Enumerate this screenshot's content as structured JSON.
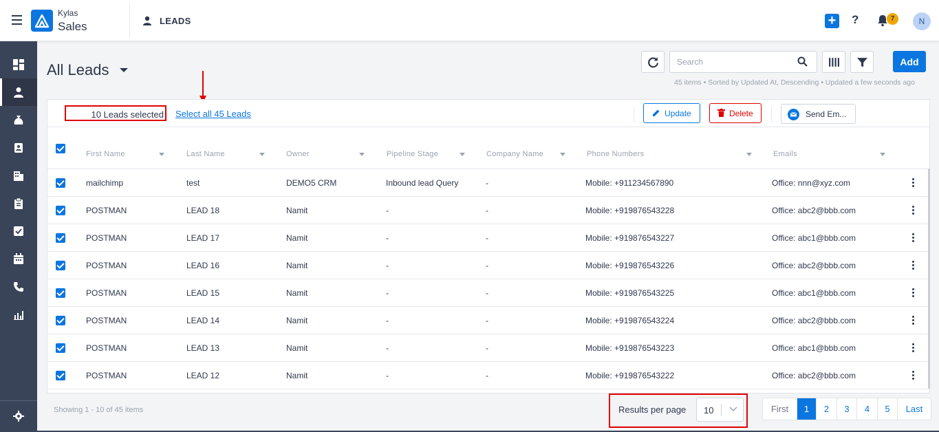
{
  "app": {
    "brand_top": "Kylas",
    "brand_sub": "Sales",
    "page_heading": "LEADS",
    "notifications_count": "7",
    "avatar_initial": "N"
  },
  "sidebar": {
    "items": [
      {
        "icon": "dashboard-icon"
      },
      {
        "icon": "leads-icon",
        "active": true
      },
      {
        "icon": "deals-icon"
      },
      {
        "icon": "contacts-icon"
      },
      {
        "icon": "companies-icon"
      },
      {
        "icon": "tasks-clipboard-icon"
      },
      {
        "icon": "checkbox-icon"
      },
      {
        "icon": "calendar-icon"
      },
      {
        "icon": "phone-icon"
      },
      {
        "icon": "reports-icon"
      }
    ],
    "settings_icon": "settings-icon"
  },
  "header": {
    "title": "All Leads",
    "search_placeholder": "Search",
    "add_label": "Add",
    "meta": "45 items • Sorted by Updated At, Descending • Updated a few seconds ago"
  },
  "bulk": {
    "selected_text": "10 Leads selected",
    "select_all": "Select all 45 Leads",
    "update_label": "Update",
    "delete_label": "Delete",
    "email_label": "Send Em..."
  },
  "table": {
    "columns": [
      "First Name",
      "Last Name",
      "Owner",
      "Pipeline Stage",
      "Company Name",
      "Phone Numbers",
      "Emails"
    ],
    "rows": [
      {
        "first": "mailchimp",
        "last": "test",
        "owner": "DEMO5 CRM",
        "stage": "Inbound lead Query",
        "company": "-",
        "phone": "Mobile: +911234567890",
        "email": "Office: nnn@xyz.com"
      },
      {
        "first": "POSTMAN",
        "last": "LEAD 18",
        "owner": "Namit",
        "stage": "-",
        "company": "-",
        "phone": "Mobile: +919876543228",
        "email": "Office: abc2@bbb.com"
      },
      {
        "first": "POSTMAN",
        "last": "LEAD 17",
        "owner": "Namit",
        "stage": "-",
        "company": "-",
        "phone": "Mobile: +919876543227",
        "email": "Office: abc1@bbb.com"
      },
      {
        "first": "POSTMAN",
        "last": "LEAD 16",
        "owner": "Namit",
        "stage": "-",
        "company": "-",
        "phone": "Mobile: +919876543226",
        "email": "Office: abc2@bbb.com"
      },
      {
        "first": "POSTMAN",
        "last": "LEAD 15",
        "owner": "Namit",
        "stage": "-",
        "company": "-",
        "phone": "Mobile: +919876543225",
        "email": "Office: abc1@bbb.com"
      },
      {
        "first": "POSTMAN",
        "last": "LEAD 14",
        "owner": "Namit",
        "stage": "-",
        "company": "-",
        "phone": "Mobile: +919876543224",
        "email": "Office: abc2@bbb.com"
      },
      {
        "first": "POSTMAN",
        "last": "LEAD 13",
        "owner": "Namit",
        "stage": "-",
        "company": "-",
        "phone": "Mobile: +919876543223",
        "email": "Office: abc1@bbb.com"
      },
      {
        "first": "POSTMAN",
        "last": "LEAD 12",
        "owner": "Namit",
        "stage": "-",
        "company": "-",
        "phone": "Mobile: +919876543222",
        "email": "Office: abc2@bbb.com"
      }
    ]
  },
  "footer": {
    "showing": "Showing 1 - 10 of 45 items",
    "rpp_label": "Results per page",
    "rpp_value": "10",
    "pages": [
      "First",
      "1",
      "2",
      "3",
      "4",
      "5",
      "Last"
    ],
    "active_page": "1"
  },
  "colors": {
    "accent": "#0b76e0",
    "sidebar": "#3a4459",
    "danger": "#e00000",
    "badge": "#f0a500"
  }
}
